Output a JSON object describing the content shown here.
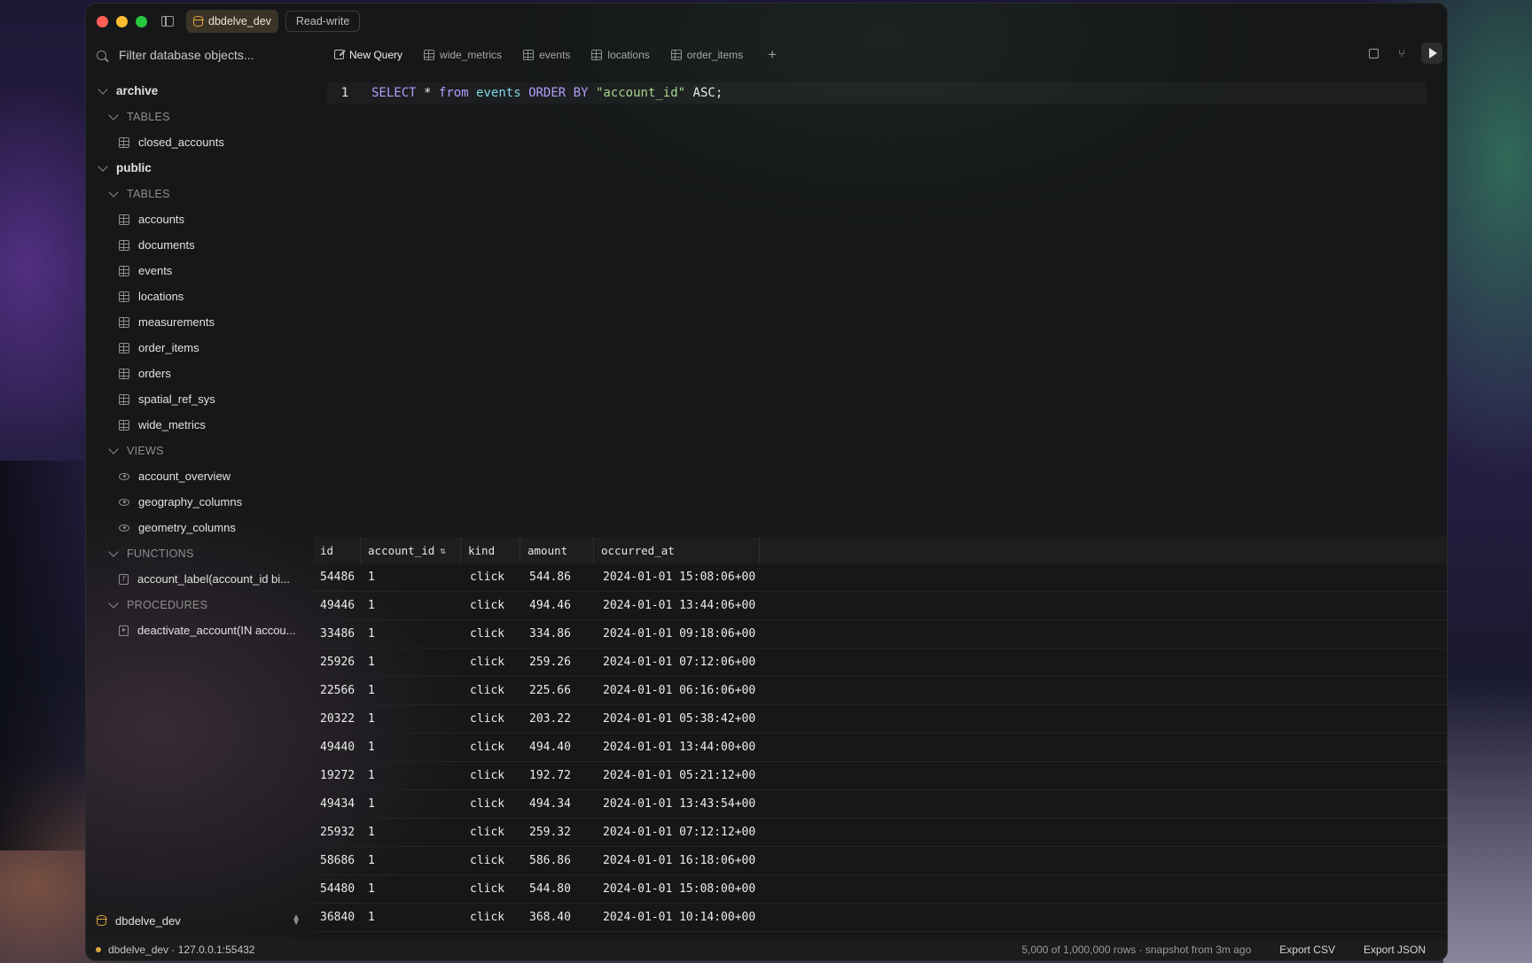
{
  "titlebar": {
    "database": "dbdelve_dev",
    "mode": "Read-write"
  },
  "sidebar": {
    "filter_placeholder": "Filter database objects...",
    "schemas": [
      {
        "name": "archive",
        "sections": [
          {
            "label": "TABLES",
            "items": [
              "closed_accounts"
            ]
          }
        ]
      },
      {
        "name": "public",
        "sections": [
          {
            "label": "TABLES",
            "items": [
              "accounts",
              "documents",
              "events",
              "locations",
              "measurements",
              "order_items",
              "orders",
              "spatial_ref_sys",
              "wide_metrics"
            ]
          },
          {
            "label": "VIEWS",
            "items": [
              "account_overview",
              "geography_columns",
              "geometry_columns"
            ]
          },
          {
            "label": "FUNCTIONS",
            "items": [
              "account_label(account_id bi..."
            ]
          },
          {
            "label": "PROCEDURES",
            "items": [
              "deactivate_account(IN accou..."
            ]
          }
        ]
      }
    ],
    "connection": "dbdelve_dev"
  },
  "tabs": {
    "items": [
      "New Query",
      "wide_metrics",
      "events",
      "locations",
      "order_items"
    ],
    "add": "+"
  },
  "editor": {
    "line_number": "1",
    "tokens": {
      "t1": "SELECT",
      "t2": "*",
      "t3": "from",
      "t4": "events",
      "t5": "ORDER BY",
      "t6": "\"account_id\"",
      "t7": "ASC;"
    }
  },
  "results": {
    "columns": [
      "id",
      "account_id",
      "kind",
      "amount",
      "occurred_at"
    ],
    "sort_indicator": "⇅",
    "rows": [
      [
        "54486",
        "1",
        "click",
        "544.86",
        "2024-01-01 15:08:06+00"
      ],
      [
        "49446",
        "1",
        "click",
        "494.46",
        "2024-01-01 13:44:06+00"
      ],
      [
        "33486",
        "1",
        "click",
        "334.86",
        "2024-01-01 09:18:06+00"
      ],
      [
        "25926",
        "1",
        "click",
        "259.26",
        "2024-01-01 07:12:06+00"
      ],
      [
        "22566",
        "1",
        "click",
        "225.66",
        "2024-01-01 06:16:06+00"
      ],
      [
        "20322",
        "1",
        "click",
        "203.22",
        "2024-01-01 05:38:42+00"
      ],
      [
        "49440",
        "1",
        "click",
        "494.40",
        "2024-01-01 13:44:00+00"
      ],
      [
        "19272",
        "1",
        "click",
        "192.72",
        "2024-01-01 05:21:12+00"
      ],
      [
        "49434",
        "1",
        "click",
        "494.34",
        "2024-01-01 13:43:54+00"
      ],
      [
        "25932",
        "1",
        "click",
        "259.32",
        "2024-01-01 07:12:12+00"
      ],
      [
        "58686",
        "1",
        "click",
        "586.86",
        "2024-01-01 16:18:06+00"
      ],
      [
        "54480",
        "1",
        "click",
        "544.80",
        "2024-01-01 15:08:00+00"
      ],
      [
        "36840",
        "1",
        "click",
        "368.40",
        "2024-01-01 10:14:00+00"
      ]
    ]
  },
  "statusbar": {
    "connection": "dbdelve_dev · 127.0.0.1:55432",
    "summary": "5,000 of 1,000,000 rows · snapshot from 3m ago",
    "export_csv": "Export CSV",
    "export_json": "Export JSON"
  },
  "colors": {
    "accent": "#e0a43a",
    "keyword": "#b59cff",
    "identifier": "#7fd6e6",
    "string": "#a6d78a"
  }
}
